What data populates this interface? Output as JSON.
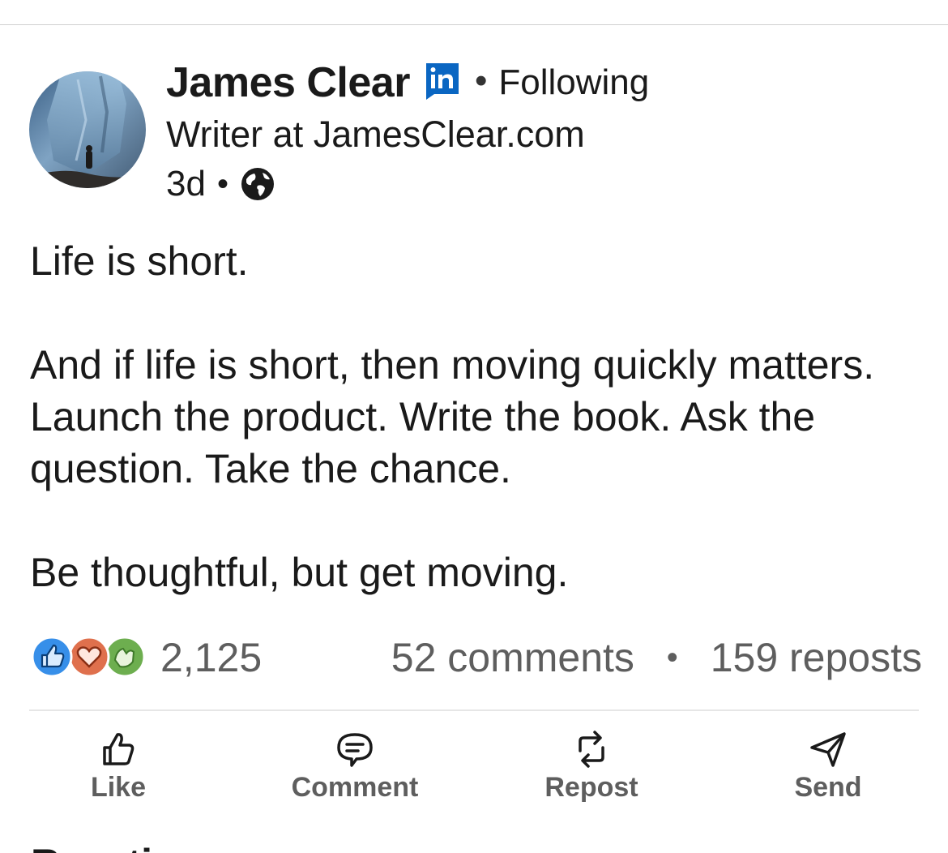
{
  "author": {
    "name": "James Clear",
    "badge_icon": "linkedin-logo-icon",
    "follow_status": "Following",
    "headline": "Writer at JamesClear.com",
    "post_age": "3d",
    "visibility_icon": "globe-icon"
  },
  "post": {
    "paragraphs": [
      "Life is short.",
      "And if life is short, then moving quickly matters. Launch the product. Write the book. Ask the question. Take the chance.",
      "Be thoughtful, but get moving."
    ]
  },
  "social": {
    "reaction_icons": [
      "like-reaction-icon",
      "love-reaction-icon",
      "celebrate-reaction-icon"
    ],
    "reaction_count": "2,125",
    "comments": "52 comments",
    "reposts": "159 reposts"
  },
  "actions": {
    "like": "Like",
    "comment": "Comment",
    "repost": "Repost",
    "send": "Send"
  },
  "next_section": {
    "title": "Reactions"
  },
  "colors": {
    "linkedin_blue": "#0a66c2",
    "like_blue": "#378fe9",
    "love_red": "#df704d",
    "celebrate_green": "#6dae4f",
    "muted_text": "#5e5e5e"
  }
}
